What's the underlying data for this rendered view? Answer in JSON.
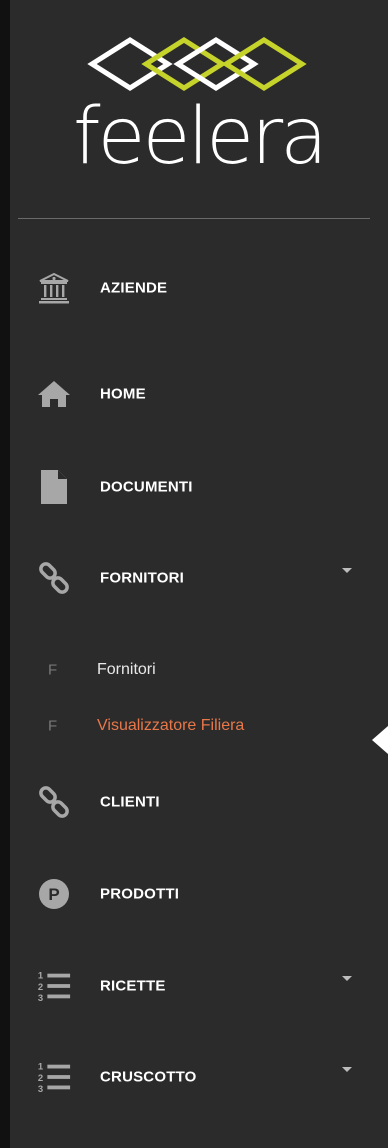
{
  "brand": {
    "name": "feelera",
    "accent": "#c5d32a"
  },
  "nav": {
    "aziende": {
      "label": "AZIENDE",
      "icon": "bank-icon"
    },
    "home": {
      "label": "HOME",
      "icon": "home-icon"
    },
    "documenti": {
      "label": "DOCUMENTI",
      "icon": "document-icon"
    },
    "fornitori": {
      "label": "FORNITORI",
      "icon": "link-icon",
      "expanded": true,
      "sub": [
        {
          "letter": "F",
          "label": "Fornitori"
        },
        {
          "letter": "F",
          "label": "Visualizzatore Filiera",
          "active": true
        }
      ]
    },
    "clienti": {
      "label": "CLIENTI",
      "icon": "link-icon"
    },
    "prodotti": {
      "label": "PRODOTTI",
      "icon": "p-circle-icon"
    },
    "ricette": {
      "label": "RICETTE",
      "icon": "ordered-list-icon"
    },
    "cruscotto": {
      "label": "CRUSCOTTO",
      "icon": "ordered-list-icon"
    }
  },
  "colors": {
    "sidebar_bg": "#2b2b2b",
    "text": "#ffffff",
    "active_text": "#e8774a",
    "icon": "#a7a7a7"
  }
}
